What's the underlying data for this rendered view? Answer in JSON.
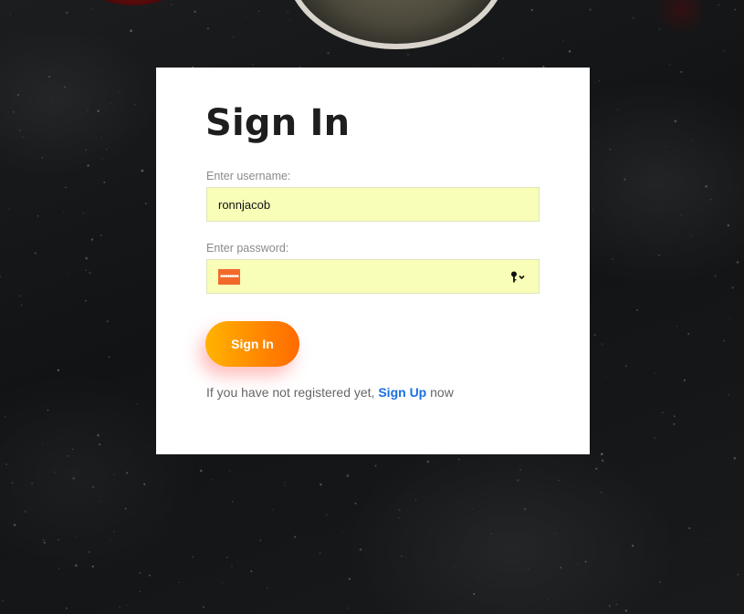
{
  "card": {
    "title": "Sign In",
    "username": {
      "label": "Enter username:",
      "value": "ronnjacob"
    },
    "password": {
      "label": "Enter password:",
      "masked_value": "••••••••",
      "autofill_icon": "key-icon"
    },
    "submit_label": "Sign In",
    "register_prompt": {
      "prefix": "If you have not registered yet,",
      "link_label": "Sign Up",
      "suffix": "now"
    }
  },
  "colors": {
    "background": "#141618",
    "card": "#ffffff",
    "input_autofill": "#f8fdb7",
    "button_gradient_start": "#ffb300",
    "button_gradient_end": "#ff6a00",
    "link": "#1a6fe0",
    "title": "#1e1e1e"
  }
}
